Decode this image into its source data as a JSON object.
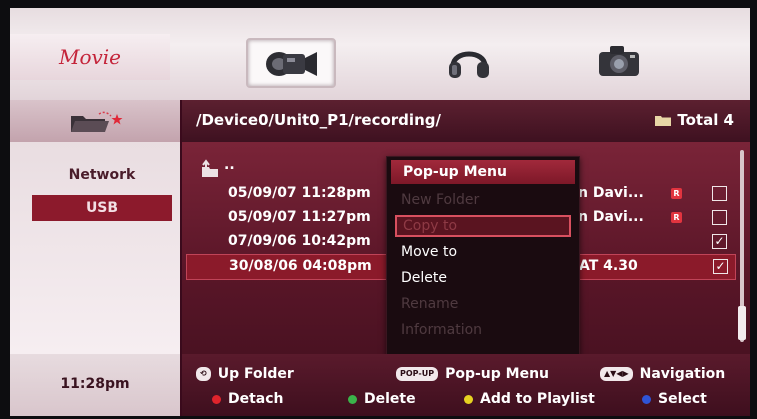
{
  "header": {
    "section_title": "Movie",
    "tabs": [
      {
        "icon": "movie-camera-icon",
        "selected": true
      },
      {
        "icon": "headphones-icon",
        "selected": false
      },
      {
        "icon": "photo-camera-icon",
        "selected": false
      }
    ]
  },
  "browser": {
    "path": "/Device0/Unit0_P1/recording/",
    "total_label": "Total 4",
    "parent_label": ".."
  },
  "sidebar": {
    "items": [
      {
        "label": "Network",
        "active": false
      },
      {
        "label": "USB",
        "active": true
      }
    ]
  },
  "files": [
    {
      "date": "05/09/07 11:28pm",
      "title": "n Davi...",
      "rec_badge": "R",
      "checked": false,
      "highlight": false
    },
    {
      "date": "05/09/07 11:27pm",
      "title": "n Davi...",
      "rec_badge": "R",
      "checked": false,
      "highlight": false
    },
    {
      "date": "07/09/06 10:42pm",
      "title": "",
      "rec_badge": "",
      "checked": true,
      "highlight": false
    },
    {
      "date": "30/08/06 04:08pm",
      "title": "AT 4.30",
      "rec_badge": "",
      "checked": true,
      "highlight": true
    }
  ],
  "popup": {
    "title": "Pop-up Menu",
    "items": [
      {
        "label": "New Folder",
        "state": "disabled"
      },
      {
        "label": "Copy to",
        "state": "focused"
      },
      {
        "label": "Move to",
        "state": "enabled"
      },
      {
        "label": "Delete",
        "state": "enabled"
      },
      {
        "label": "Rename",
        "state": "disabled"
      },
      {
        "label": "Information",
        "state": "disabled"
      }
    ]
  },
  "footer": {
    "clock": "11:28pm",
    "up_folder": {
      "key": "",
      "label": "Up Folder"
    },
    "popup_menu": {
      "key": "POP-UP",
      "label": "Pop-up Menu"
    },
    "navigation": {
      "key": "▲▼◀▶",
      "label": "Navigation"
    },
    "detach": {
      "color": "#e0242c",
      "label": "Detach"
    },
    "delete": {
      "color": "#3bb34a",
      "label": "Delete"
    },
    "add_playlist": {
      "color": "#e6d221",
      "label": "Add to Playlist"
    },
    "select": {
      "color": "#2f54d6",
      "label": "Select"
    }
  }
}
